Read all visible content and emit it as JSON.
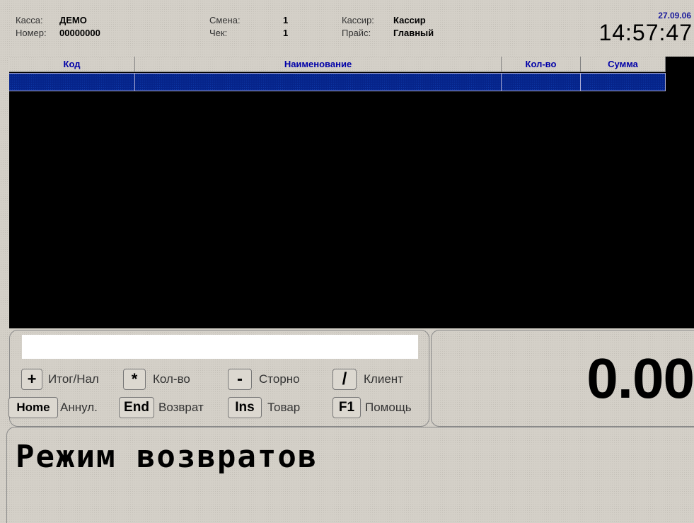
{
  "header": {
    "kassa_label": "Касса:",
    "kassa_value": "ДЕМО",
    "nomer_label": "Номер:",
    "nomer_value": "00000000",
    "smena_label": "Смена:",
    "smena_value": "1",
    "chek_label": "Чек:",
    "chek_value": "1",
    "kassir_label": "Кассир:",
    "kassir_value": "Кассир",
    "prais_label": "Прайс:",
    "prais_value": "Главный",
    "date": "27.09.06",
    "time": "14:57:47"
  },
  "table": {
    "columns": [
      "Код",
      "Наименование",
      "Кол-во",
      "Сумма"
    ]
  },
  "input": {
    "value": "",
    "placeholder": ""
  },
  "keys": [
    {
      "key": "+",
      "label": "Итог/Нал"
    },
    {
      "key": "*",
      "label": "Кол-во"
    },
    {
      "key": "-",
      "label": "Сторно"
    },
    {
      "key": "/",
      "label": "Клиент"
    },
    {
      "key": "Home",
      "label": "Аннул."
    },
    {
      "key": "End",
      "label": "Возврат"
    },
    {
      "key": "Ins",
      "label": "Товар"
    },
    {
      "key": "F1",
      "label": "Помощь"
    }
  ],
  "total": "0.00",
  "status_message": "Режим возвратов",
  "colors": {
    "header_text": "#0000a8",
    "selected_row": "#06248a",
    "grid_bg": "#000000"
  }
}
